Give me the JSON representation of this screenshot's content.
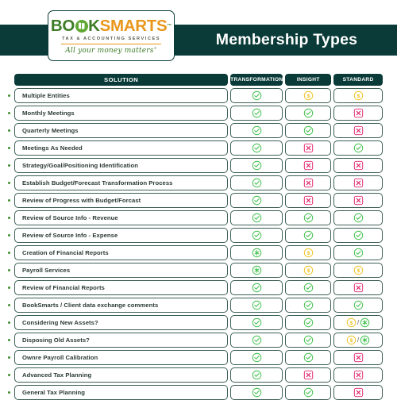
{
  "header": {
    "title": "Membership Types",
    "band_color": "#0a3b38",
    "logo": {
      "word_part1": "BO",
      "word_oicon": "book-circle-icon",
      "word_part2": "K",
      "word_part3": "SMARTS",
      "trademark": "™",
      "subtitle": "TAX & ACCOUNTING SERVICES",
      "tagline": "All your money matters",
      "tagline_mark": "®",
      "green": "#3e7d28",
      "orange": "#e8971d"
    }
  },
  "table": {
    "columns": [
      {
        "key": "solution",
        "label": "SOLUTION"
      },
      {
        "key": "transformation",
        "label": "TRANSFORMATION"
      },
      {
        "key": "insight",
        "label": "INSIGHT"
      },
      {
        "key": "standard",
        "label": "STANDARD"
      }
    ],
    "icon_legend": {
      "check": "green-check-circle-icon",
      "dollar": "yellow-dollar-circle-icon",
      "cross": "pink-cross-square-icon",
      "asterisk": "green-asterisk-circle-icon",
      "dollar_or_asterisk": "dollar-or-asterisk-combo-icon"
    },
    "colors": {
      "check": "#3fbf4a",
      "dollar": "#efc222",
      "cross": "#e4236b",
      "asterisk": "#3fbf4a",
      "cell_border": "#3d5f57",
      "header_bg": "#0a3b38",
      "text": "#2b3a36"
    },
    "rows": [
      {
        "solution": "Multiple Entities",
        "transformation": "check",
        "insight": "dollar",
        "standard": "dollar"
      },
      {
        "solution": "Monthly Meetings",
        "transformation": "check",
        "insight": "check",
        "standard": "cross"
      },
      {
        "solution": "Quarterly Meetings",
        "transformation": "check",
        "insight": "check",
        "standard": "cross"
      },
      {
        "solution": "Meetings As Needed",
        "transformation": "check",
        "insight": "cross",
        "standard": "check"
      },
      {
        "solution": "Strategy/Goal/Positioning Identification",
        "transformation": "check",
        "insight": "cross",
        "standard": "cross"
      },
      {
        "solution": "Establish Budget/Forecast Transformation Process",
        "transformation": "check",
        "insight": "cross",
        "standard": "cross"
      },
      {
        "solution": "Review of Progress with Budget/Forcast",
        "transformation": "check",
        "insight": "cross",
        "standard": "cross"
      },
      {
        "solution": "Review of Source Info - Revenue",
        "transformation": "check",
        "insight": "check",
        "standard": "check"
      },
      {
        "solution": "Review of Source Info - Expense",
        "transformation": "check",
        "insight": "check",
        "standard": "check"
      },
      {
        "solution": "Creation of Financial Reports",
        "transformation": "asterisk",
        "insight": "dollar",
        "standard": "check"
      },
      {
        "solution": "Payroll Services",
        "transformation": "asterisk",
        "insight": "dollar",
        "standard": "dollar"
      },
      {
        "solution": "Review of Financial Reports",
        "transformation": "check",
        "insight": "check",
        "standard": "cross"
      },
      {
        "solution": "BookSmarts / Client data exchange comments",
        "transformation": "check",
        "insight": "check",
        "standard": "check"
      },
      {
        "solution": "Considering New Assets?",
        "transformation": "check",
        "insight": "check",
        "standard": "dollar_or_asterisk"
      },
      {
        "solution": "Disposing Old Assets?",
        "transformation": "check",
        "insight": "check",
        "standard": "dollar_or_asterisk"
      },
      {
        "solution": "Ownre Payroll Calibration",
        "transformation": "check",
        "insight": "check",
        "standard": "cross"
      },
      {
        "solution": "Advanced Tax Planning",
        "transformation": "check",
        "insight": "cross",
        "standard": "cross"
      },
      {
        "solution": "General Tax Planning",
        "transformation": "check",
        "insight": "check",
        "standard": "cross"
      }
    ]
  }
}
